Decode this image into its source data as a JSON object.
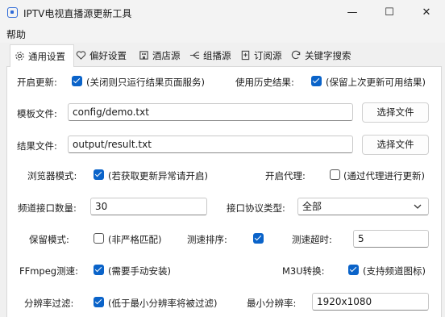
{
  "window": {
    "title": "IPTV电视直播源更新工具",
    "minimize_glyph": "—",
    "maximize_glyph": "☐",
    "close_glyph": "✕"
  },
  "menu": {
    "help": "帮助"
  },
  "tabs": [
    {
      "label": "通用设置",
      "icon": "gear-icon",
      "active": true
    },
    {
      "label": "偏好设置",
      "icon": "heart-icon"
    },
    {
      "label": "酒店源",
      "icon": "hotel-icon"
    },
    {
      "label": "组播源",
      "icon": "multicast-icon"
    },
    {
      "label": "订阅源",
      "icon": "bookmark-icon"
    },
    {
      "label": "关键字搜索",
      "icon": "search-refresh-icon"
    }
  ],
  "general": {
    "open_update": {
      "label": "开启更新:",
      "checked": true,
      "desc": "(关闭则只运行结果页面服务)"
    },
    "use_history": {
      "label": "使用历史结果:",
      "checked": true,
      "desc": "(保留上次更新可用结果)"
    },
    "template_file": {
      "label": "模板文件:",
      "value": "config/demo.txt",
      "button": "选择文件"
    },
    "result_file": {
      "label": "结果文件:",
      "value": "output/result.txt",
      "button": "选择文件"
    },
    "browser_mode": {
      "label": "浏览器模式:",
      "checked": true,
      "desc": "(若获取更新异常请开启)"
    },
    "proxy": {
      "label": "开启代理:",
      "checked": false,
      "desc": "(通过代理进行更新)"
    },
    "channel_count": {
      "label": "频道接口数量:",
      "value": "30"
    },
    "protocol": {
      "label": "接口协议类型:",
      "value": "全部"
    },
    "keep_mode": {
      "label": "保留模式:",
      "checked": false,
      "desc": "(非严格匹配)"
    },
    "speed_sort": {
      "label": "测速排序:",
      "checked": true
    },
    "speed_timeout": {
      "label": "测速超时:",
      "value": "5"
    },
    "ffmpeg": {
      "label": "FFmpeg测速:",
      "checked": true,
      "desc": "(需要手动安装)"
    },
    "m3u": {
      "label": "M3U转换:",
      "checked": true,
      "desc": "(支持频道图标)"
    },
    "resolution_filter": {
      "label": "分辨率过滤:",
      "checked": true,
      "desc": "(低于最小分辨率将被过滤)"
    },
    "min_resolution": {
      "label": "最小分辨率:",
      "value": "1920x1080"
    }
  },
  "colors": {
    "accent": "#0a63c9",
    "panel_bg": "#ffffff",
    "window_bg": "#f0f0f0"
  }
}
